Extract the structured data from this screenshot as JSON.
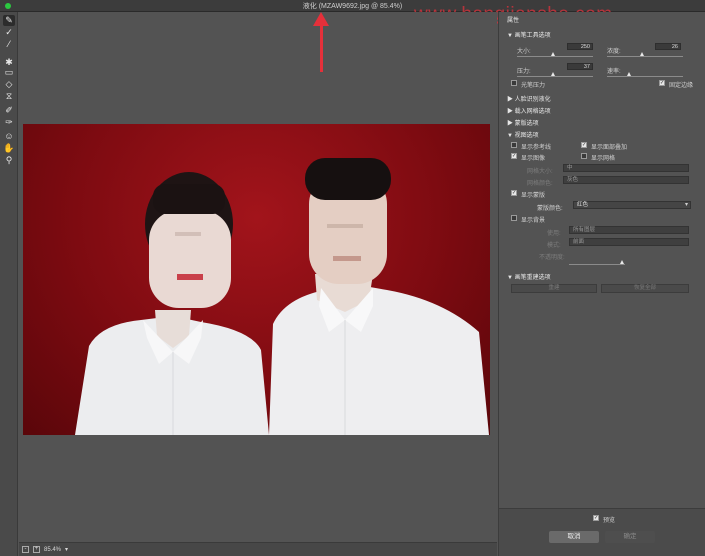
{
  "window": {
    "title": "液化 (MZAW9692.jpg @ 85.4%)",
    "watermark": "www.hangjianshe.com"
  },
  "toolbar": {
    "tools": [
      {
        "name": "forward-warp-tool-icon",
        "glyph": "✎"
      },
      {
        "name": "reconstruct-tool-icon",
        "glyph": "✓"
      },
      {
        "name": "smooth-tool-icon",
        "glyph": "⁄"
      },
      {
        "name": "twirl-tool-icon",
        "glyph": "✱"
      },
      {
        "name": "pucker-tool-icon",
        "glyph": "▭"
      },
      {
        "name": "bloat-tool-icon",
        "glyph": "◇"
      },
      {
        "name": "push-left-tool-icon",
        "glyph": "⧖"
      },
      {
        "name": "freeze-mask-tool-icon",
        "glyph": "✐"
      },
      {
        "name": "thaw-mask-tool-icon",
        "glyph": "✑"
      },
      {
        "name": "face-tool-icon",
        "glyph": "☺"
      },
      {
        "name": "hand-tool-icon",
        "glyph": "✋"
      },
      {
        "name": "zoom-tool-icon",
        "glyph": "⚲"
      }
    ]
  },
  "status": {
    "zoom": "85.4%",
    "minus": "-",
    "plus": "+"
  },
  "panel": {
    "header": "属性",
    "brush_tool_options": "▼ 画笔工具选项",
    "size_label": "大小:",
    "size_value": "250",
    "density_label": "浓度:",
    "density_value": "26",
    "pressure_label": "压力:",
    "pressure_value": "37",
    "rate_label": "速率:",
    "stylus_label": "光笔压力",
    "pin_edges_label": "固定边缘",
    "face_aware": "▶ 人脸识别液化",
    "load_mesh": "▶ 载入网格选项",
    "mask_options": "▶ 蒙版选项",
    "view_options": "▼ 视图选项",
    "show_guides": "显示参考线",
    "show_face_overlay": "显示面部叠加",
    "show_image": "显示图像",
    "show_mesh": "显示网格",
    "mesh_size_label": "网格大小:",
    "mesh_size_value": "中",
    "mesh_color_label": "网格颜色:",
    "mesh_color_value": "灰色",
    "show_mask": "显示蒙版",
    "mask_color_label": "蒙版颜色:",
    "mask_color_value": "红色",
    "show_backdrop": "显示背景",
    "use_label": "使用:",
    "use_value": "所有图层",
    "mode_label": "模式:",
    "mode_value": "前面",
    "opacity_label": "不透明度:",
    "reconstruct_options": "▼ 画笔重建选项",
    "reconstruct_button": "重建",
    "restore_all_button": "恢复全部",
    "preview_label": "预览",
    "cancel_button": "取消",
    "ok_button": "确定"
  }
}
